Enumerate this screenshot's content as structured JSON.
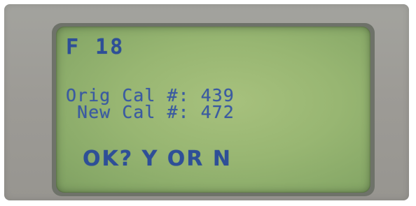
{
  "display": {
    "header": "F 18",
    "orig_cal": "Orig Cal #: 439",
    "new_cal": " New Cal #: 472",
    "prompt": "OK? Y OR N"
  },
  "colors": {
    "lcd_background": "#98b672",
    "lcd_text": "#2e4f97",
    "bezel": "#9d9b96"
  }
}
